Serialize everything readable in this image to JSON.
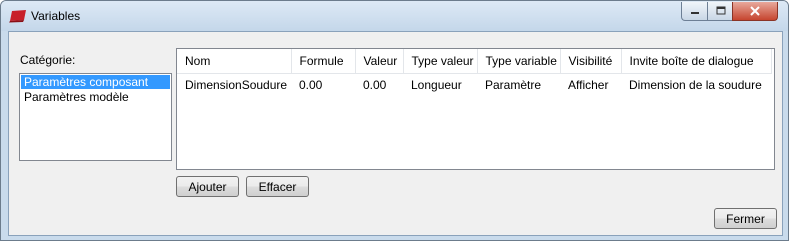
{
  "window": {
    "title": "Variables",
    "icon": "red-app-icon",
    "controls": [
      "minimize-icon",
      "maximize-icon",
      "close-icon"
    ]
  },
  "category": {
    "label": "Catégorie:",
    "items": [
      "Paramètres composant",
      "Paramètres modèle"
    ],
    "selected": "Paramètres composant"
  },
  "grid": {
    "headers": [
      "Nom",
      "Formule",
      "Valeur",
      "Type valeur",
      "Type variable",
      "Visibilité",
      "Invite boîte de dialogue"
    ],
    "rows": [
      [
        "DimensionSoudure",
        "0.00",
        "0.00",
        "Longueur",
        "Paramètre",
        "Afficher",
        "Dimension de la soudure"
      ]
    ]
  },
  "buttons": {
    "add": "Ajouter",
    "delete": "Effacer",
    "close": "Fermer"
  },
  "colors": {
    "selection": "#3399ff",
    "close_button": "#c6452f"
  }
}
